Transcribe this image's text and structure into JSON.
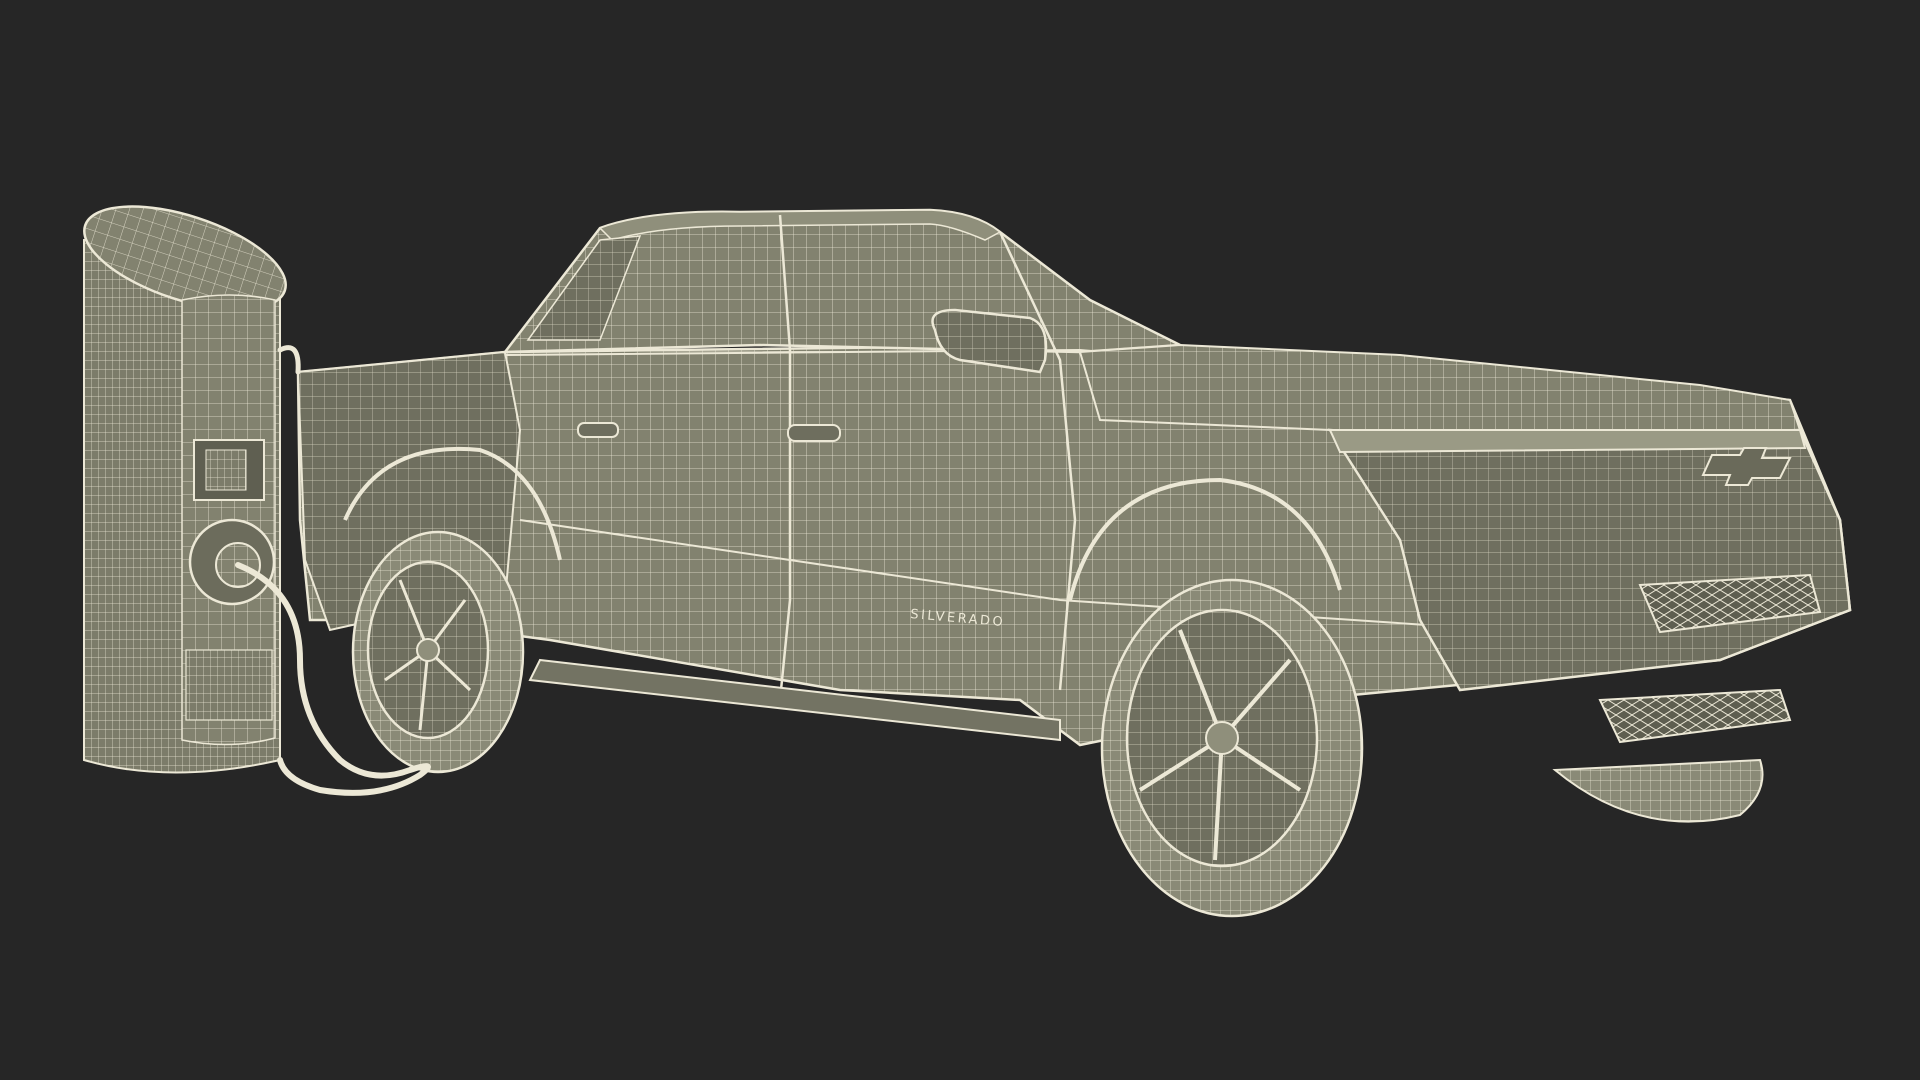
{
  "scene": {
    "background_color": "#262626",
    "surface_color": "#82826f",
    "surface_shadow_color": "#6e6e5e",
    "wire_color": "#ece8d6",
    "subjects": [
      "pickup-truck",
      "ev-charging-station",
      "charging-cable"
    ]
  },
  "truck": {
    "badge_text": "SILVERADO"
  }
}
